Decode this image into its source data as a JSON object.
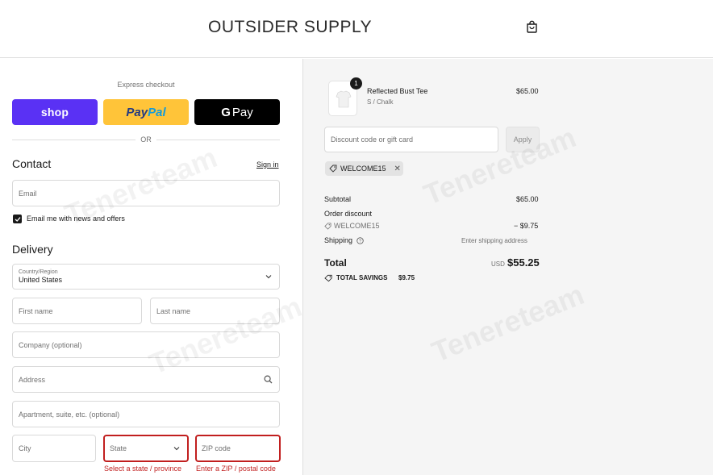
{
  "header": {
    "brand": "OUTSIDER SUPPLY",
    "icon": "shopping-bag-icon"
  },
  "express": {
    "label": "Express checkout",
    "shop_label": "shop",
    "paypal_label_1": "Pay",
    "paypal_label_2": "Pal",
    "gpay_g": "G",
    "gpay_label": "Pay",
    "or_label": "OR",
    "colors": {
      "shop": "#5a31f4",
      "paypal": "#ffc439",
      "gpay": "#000000"
    }
  },
  "contact": {
    "title": "Contact",
    "signin": "Sign in",
    "email_placeholder": "Email",
    "news_label": "Email me with news and offers",
    "news_checked": true
  },
  "delivery": {
    "title": "Delivery",
    "country_label": "Country/Region",
    "country_value": "United States",
    "first_name": "First name",
    "last_name": "Last name",
    "company": "Company (optional)",
    "address": "Address",
    "apartment": "Apartment, suite, etc. (optional)",
    "city": "City",
    "state": "State",
    "zip": "ZIP code",
    "state_error": "Select a state / province",
    "zip_error": "Enter a ZIP / postal code",
    "error_color": "#c11f1f"
  },
  "summary": {
    "product_name": "Reflected Bust Tee",
    "product_variant": "S / Chalk",
    "product_price": "$65.00",
    "quantity": "1",
    "discount_placeholder": "Discount code or gift card",
    "apply_label": "Apply",
    "applied_code": "WELCOME15",
    "subtotal_label": "Subtotal",
    "subtotal_value": "$65.00",
    "order_discount_label": "Order discount",
    "discount_code": "WELCOME15",
    "discount_value": "− $9.75",
    "shipping_label": "Shipping",
    "shipping_value": "Enter shipping address",
    "total_label": "Total",
    "currency": "USD",
    "total_value": "$55.25",
    "savings_label": "TOTAL SAVINGS",
    "savings_value": "$9.75"
  },
  "watermark": {
    "text": "Tenereteam"
  }
}
